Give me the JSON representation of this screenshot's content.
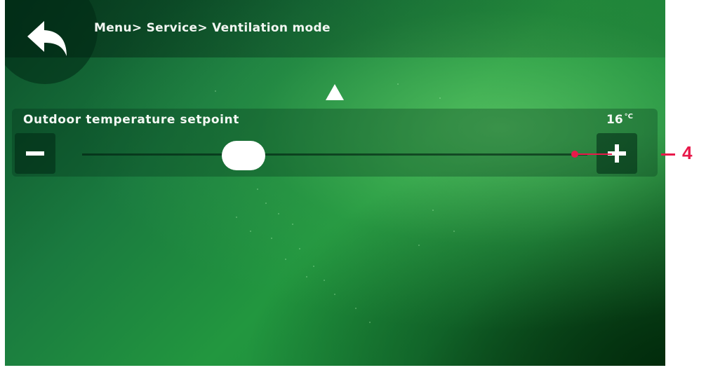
{
  "header": {
    "breadcrumb": "Menu> Service> Ventilation mode",
    "back_icon": "back-arrow-icon"
  },
  "navigation": {
    "up_icon": "up-triangle-icon"
  },
  "setting": {
    "label": "Outdoor temperature setpoint",
    "value": "16",
    "unit": "°C",
    "slider_level": 0.32
  },
  "controls": {
    "minus_icon": "minus-icon",
    "plus_icon": "plus-icon"
  },
  "callout": {
    "number": "4",
    "color": "#e8194a"
  },
  "colors": {
    "background": "#1a7a3f",
    "accent_text": "#f4f8f4",
    "thumb": "#ffffff"
  }
}
